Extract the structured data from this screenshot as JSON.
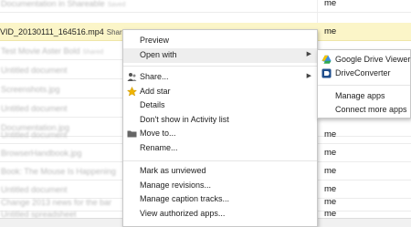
{
  "file_list": {
    "rows": [
      {
        "name": "Documentation in Shareable",
        "shared": "Saved",
        "owner": "me"
      },
      {
        "name": "VID_20130111_164516.mp4",
        "shared": "Shared",
        "owner": "me"
      },
      {
        "name": "Test Movie Aster Bold",
        "shared": "Shared",
        "owner": ""
      },
      {
        "name": "Untitled document",
        "shared": "",
        "owner": ""
      },
      {
        "name": "Screenshots.jpg",
        "shared": "",
        "owner": ""
      },
      {
        "name": "Untitled document",
        "shared": "",
        "owner": ""
      },
      {
        "name": "Documentation.jpg",
        "shared": "",
        "owner": ""
      },
      {
        "name": "Untitled document",
        "shared": "",
        "owner": "me"
      },
      {
        "name": "BrowserHandbook.jpg",
        "shared": "",
        "owner": "me"
      },
      {
        "name": "Book: The Mouse Is Happening",
        "shared": "",
        "owner": "me"
      },
      {
        "name": "Untitled document",
        "shared": "",
        "owner": "me"
      },
      {
        "name": "Change 2013 news for the bar",
        "shared": "",
        "owner": "me"
      },
      {
        "name": "Untitled spreadsheet",
        "shared": "",
        "owner": "me"
      }
    ]
  },
  "context_menu": {
    "items": [
      {
        "label": "Preview",
        "icon": "",
        "submenu": false
      },
      {
        "label": "Open with",
        "icon": "",
        "submenu": true
      },
      {
        "label": "Share...",
        "icon": "share-people-icon",
        "submenu": true
      },
      {
        "label": "Add star",
        "icon": "star-icon",
        "submenu": false
      },
      {
        "label": "Details",
        "icon": "",
        "submenu": false
      },
      {
        "label": "Don't show in Activity list",
        "icon": "",
        "submenu": false
      },
      {
        "label": "Move to...",
        "icon": "folder-icon",
        "submenu": false
      },
      {
        "label": "Rename...",
        "icon": "",
        "submenu": false
      },
      {
        "label": "Mark as unviewed",
        "icon": "",
        "submenu": false
      },
      {
        "label": "Manage revisions...",
        "icon": "",
        "submenu": false
      },
      {
        "label": "Manage caption tracks...",
        "icon": "",
        "submenu": false
      },
      {
        "label": "View authorized apps...",
        "icon": "",
        "submenu": false
      }
    ],
    "submenu_arrow": "▶"
  },
  "open_with_submenu": {
    "items": [
      {
        "label": "Google Drive Viewer",
        "icon": "drive-icon"
      },
      {
        "label": "DriveConverter",
        "icon": "driveconverter-icon"
      },
      {
        "label": "Manage apps",
        "icon": ""
      },
      {
        "label": "Connect more apps",
        "icon": ""
      }
    ]
  },
  "colors": {
    "selected_row": "#fbf5c8",
    "menu_highlight": "#eeeeee",
    "star": "#f0b400"
  }
}
